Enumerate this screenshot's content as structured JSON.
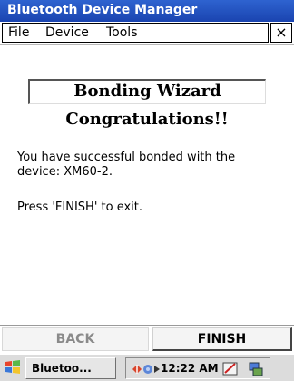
{
  "window": {
    "title": "Bluetooth Device Manager"
  },
  "menu": {
    "items": [
      {
        "label": "File"
      },
      {
        "label": "Device"
      },
      {
        "label": "Tools"
      }
    ],
    "close_label": "×"
  },
  "wizard": {
    "title": "Bonding Wizard",
    "congrats": "Congratulations!!",
    "message": "You have successful bonded with the device: XM60-2.",
    "exit_hint": "Press 'FINISH' to exit."
  },
  "buttons": {
    "back": "BACK",
    "finish": "FINISH"
  },
  "taskbar": {
    "task_label": "Bluetoo...",
    "time": "12:22 AM"
  },
  "colors": {
    "titlebar": "#1f4fc0",
    "button_disabled_text": "#8a8a8a"
  },
  "icons": [
    "windows-start-icon",
    "bluetooth-tray-icon",
    "network-tray-icon",
    "arrow-tray-icon",
    "pen-input-icon",
    "display-icon"
  ]
}
